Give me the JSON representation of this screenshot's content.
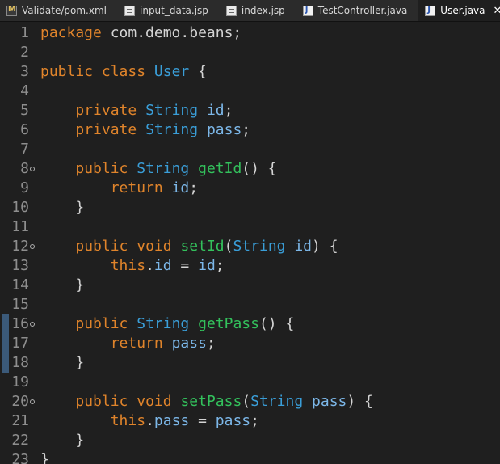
{
  "tabs": [
    {
      "label": "Validate/pom.xml",
      "icon": "xml-file-icon",
      "active": false
    },
    {
      "label": "input_data.jsp",
      "icon": "jsp-file-icon",
      "active": false
    },
    {
      "label": "index.jsp",
      "icon": "jsp-file-icon",
      "active": false
    },
    {
      "label": "TestController.java",
      "icon": "java-file-icon",
      "active": false
    },
    {
      "label": "User.java",
      "icon": "java-file-icon",
      "active": true
    }
  ],
  "close_glyph": "✕",
  "colors": {
    "background": "#1f1f1f",
    "keyword": "#e0842b",
    "type": "#3a9ed8",
    "field": "#7cb7e8",
    "method": "#33c15c",
    "plain": "#d4d4d4",
    "line_number": "#8e8e8e"
  },
  "code_lines": [
    [
      [
        "kw",
        "package"
      ],
      [
        "pln",
        " com.demo.beans;"
      ]
    ],
    [],
    [
      [
        "kw",
        "public"
      ],
      [
        "pln",
        " "
      ],
      [
        "kw",
        "class"
      ],
      [
        "pln",
        " "
      ],
      [
        "ty",
        "User"
      ],
      [
        "pln",
        " {"
      ]
    ],
    [],
    [
      [
        "pln",
        "    "
      ],
      [
        "kw",
        "private"
      ],
      [
        "pln",
        " "
      ],
      [
        "ty",
        "String"
      ],
      [
        "pln",
        " "
      ],
      [
        "fld",
        "id"
      ],
      [
        "pln",
        ";"
      ]
    ],
    [
      [
        "pln",
        "    "
      ],
      [
        "kw",
        "private"
      ],
      [
        "pln",
        " "
      ],
      [
        "ty",
        "String"
      ],
      [
        "pln",
        " "
      ],
      [
        "fld",
        "pass"
      ],
      [
        "pln",
        ";"
      ]
    ],
    [],
    [
      [
        "pln",
        "    "
      ],
      [
        "kw",
        "public"
      ],
      [
        "pln",
        " "
      ],
      [
        "ty",
        "String"
      ],
      [
        "pln",
        " "
      ],
      [
        "mth",
        "getId"
      ],
      [
        "pln",
        "() {"
      ]
    ],
    [
      [
        "pln",
        "        "
      ],
      [
        "kw",
        "return"
      ],
      [
        "pln",
        " "
      ],
      [
        "fld",
        "id"
      ],
      [
        "pln",
        ";"
      ]
    ],
    [
      [
        "pln",
        "    }"
      ]
    ],
    [],
    [
      [
        "pln",
        "    "
      ],
      [
        "kw",
        "public"
      ],
      [
        "pln",
        " "
      ],
      [
        "kw",
        "void"
      ],
      [
        "pln",
        " "
      ],
      [
        "mth",
        "setId"
      ],
      [
        "pln",
        "("
      ],
      [
        "ty",
        "String"
      ],
      [
        "pln",
        " "
      ],
      [
        "fld",
        "id"
      ],
      [
        "pln",
        ") {"
      ]
    ],
    [
      [
        "pln",
        "        "
      ],
      [
        "kw",
        "this"
      ],
      [
        "pln",
        "."
      ],
      [
        "fld",
        "id"
      ],
      [
        "pln",
        " = "
      ],
      [
        "fld",
        "id"
      ],
      [
        "pln",
        ";"
      ]
    ],
    [
      [
        "pln",
        "    }"
      ]
    ],
    [],
    [
      [
        "pln",
        "    "
      ],
      [
        "kw",
        "public"
      ],
      [
        "pln",
        " "
      ],
      [
        "ty",
        "String"
      ],
      [
        "pln",
        " "
      ],
      [
        "mth",
        "getPass"
      ],
      [
        "pln",
        "() {"
      ]
    ],
    [
      [
        "pln",
        "        "
      ],
      [
        "kw",
        "return"
      ],
      [
        "pln",
        " "
      ],
      [
        "fld",
        "pass"
      ],
      [
        "pln",
        ";"
      ]
    ],
    [
      [
        "pln",
        "    }"
      ]
    ],
    [],
    [
      [
        "pln",
        "    "
      ],
      [
        "kw",
        "public"
      ],
      [
        "pln",
        " "
      ],
      [
        "kw",
        "void"
      ],
      [
        "pln",
        " "
      ],
      [
        "mth",
        "setPass"
      ],
      [
        "pln",
        "("
      ],
      [
        "ty",
        "String"
      ],
      [
        "pln",
        " "
      ],
      [
        "fld",
        "pass"
      ],
      [
        "pln",
        ") {"
      ]
    ],
    [
      [
        "pln",
        "        "
      ],
      [
        "kw",
        "this"
      ],
      [
        "pln",
        "."
      ],
      [
        "fld",
        "pass"
      ],
      [
        "pln",
        " = "
      ],
      [
        "fld",
        "pass"
      ],
      [
        "pln",
        ";"
      ]
    ],
    [
      [
        "pln",
        "    }"
      ]
    ],
    [
      [
        "pln",
        "}"
      ]
    ]
  ],
  "line_numbers": [
    "1",
    "2",
    "3",
    "4",
    "5",
    "6",
    "7",
    "8",
    "9",
    "10",
    "11",
    "12",
    "13",
    "14",
    "15",
    "16",
    "17",
    "18",
    "19",
    "20",
    "21",
    "22",
    "23"
  ],
  "fold_lines": [
    8,
    12,
    16,
    20
  ],
  "changed_lines": [
    16,
    17,
    18
  ]
}
